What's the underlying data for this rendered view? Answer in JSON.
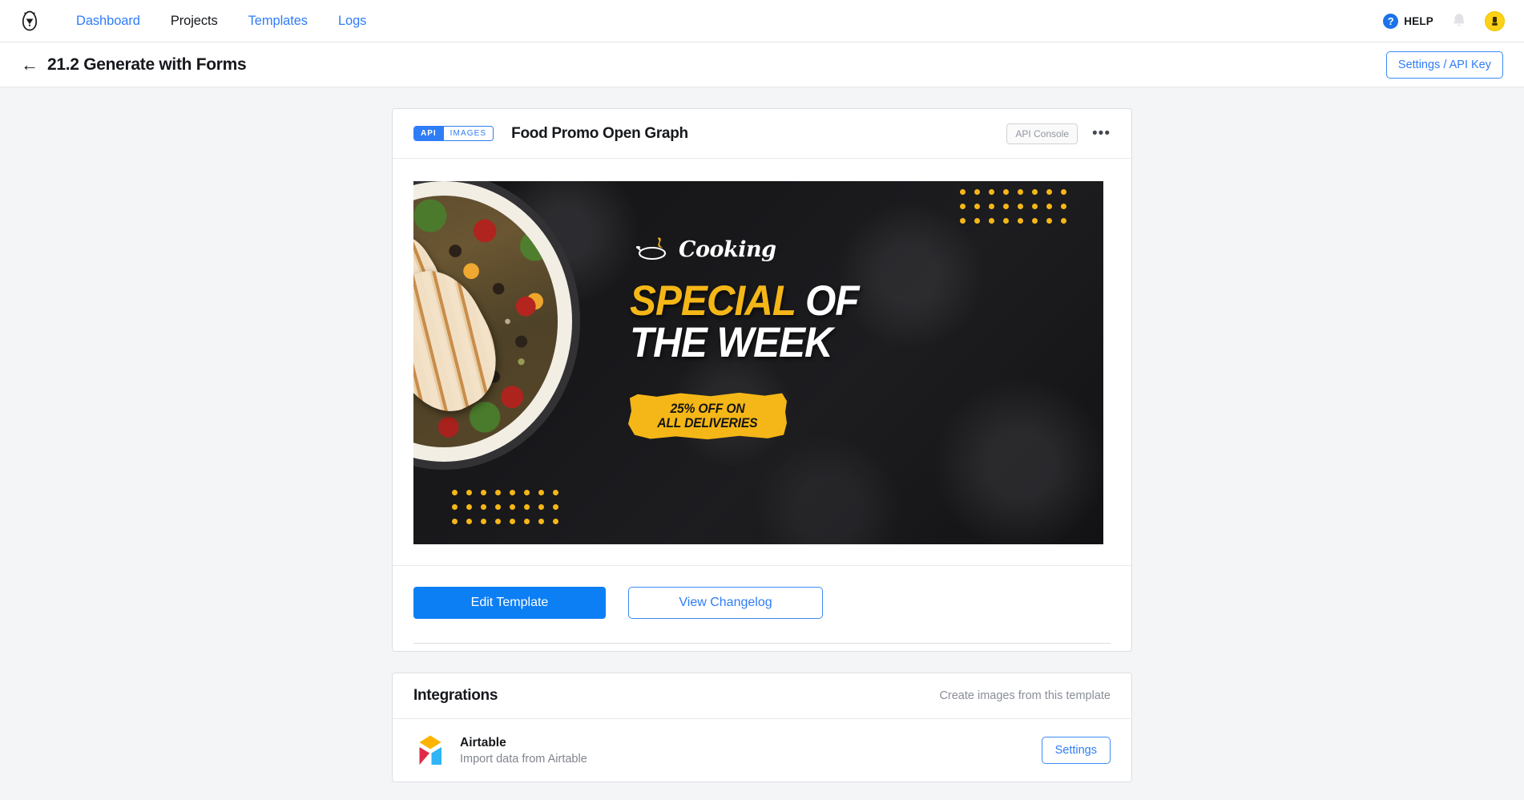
{
  "nav": {
    "logo_icon": "egg-logo-icon",
    "links": [
      {
        "label": "Dashboard",
        "active": false
      },
      {
        "label": "Projects",
        "active": true
      },
      {
        "label": "Templates",
        "active": false
      },
      {
        "label": "Logs",
        "active": false
      }
    ],
    "help": {
      "glyph": "?",
      "label": "HELP"
    },
    "bell_icon": "notification-bell-icon",
    "avatar_icon": "user-avatar-icon"
  },
  "titlebar": {
    "back_glyph": "←",
    "title": "21.2 Generate with Forms",
    "settings_button": "Settings / API Key"
  },
  "template_card": {
    "badge_api": "API",
    "badge_images": "IMAGES",
    "title": "Food Promo Open Graph",
    "api_console_button": "API Console",
    "menu_glyph": "•••",
    "preview": {
      "brand": "Cooking",
      "headline_line1_yellow": "SPECIAL",
      "headline_line1_white": "OF",
      "headline_line2": "THE WEEK",
      "promo_badge_line1": "25% OFF ON",
      "promo_badge_line2": "ALL DELIVERIES",
      "accent_color": "#f5b717",
      "background_color": "#141416",
      "dot_rows": 3,
      "dot_cols": 8
    },
    "actions": {
      "edit_template": "Edit Template",
      "view_changelog": "View Changelog"
    }
  },
  "integrations": {
    "title": "Integrations",
    "subtitle": "Create images from this template",
    "items": [
      {
        "name": "Airtable",
        "description": "Import data from Airtable",
        "button": "Settings",
        "logo_icon": "airtable-logo-icon"
      }
    ]
  }
}
